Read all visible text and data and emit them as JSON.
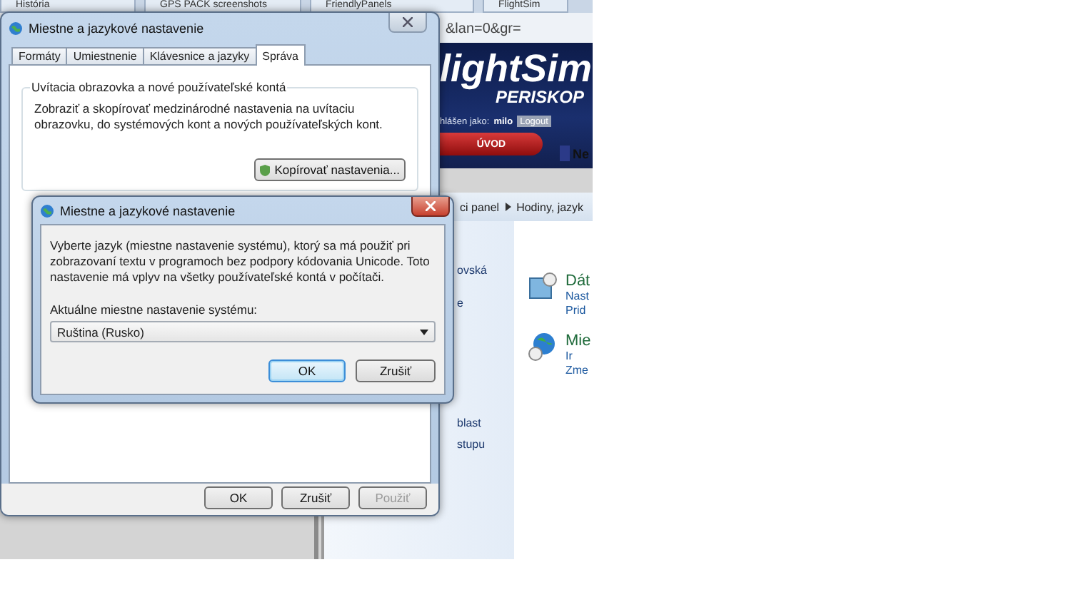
{
  "browser": {
    "tabs": [
      "História",
      "GPS PACK screenshots",
      "FriendlyPanels",
      "FlightSim"
    ],
    "address": "&lan=0&gr="
  },
  "site": {
    "logo": "lightSim",
    "subtitle": "PERISKOP",
    "login_label": "hlášen jako:",
    "user": "milo",
    "logout": "Logout",
    "nav": "ÚVOD",
    "cut_text": "Ne"
  },
  "control_panel": {
    "breadcrumb": [
      "ci panel",
      "Hodiny, jazyk"
    ],
    "left_links": [
      "ovská",
      "e",
      "blast",
      "stupu"
    ],
    "items": [
      {
        "title": "Dát",
        "links": [
          "Nast",
          "Prid"
        ]
      },
      {
        "title": "Mie",
        "links": [
          "Ir",
          "Zme"
        ]
      }
    ]
  },
  "main_dialog": {
    "title": "Miestne a jazykové nastavenie",
    "tabs": [
      {
        "label": "Formáty",
        "selected": false
      },
      {
        "label": "Umiestnenie",
        "selected": false
      },
      {
        "label": "Klávesnice a jazyky",
        "selected": false
      },
      {
        "label": "Správa",
        "selected": true
      }
    ],
    "group_title": "Uvítacia obrazovka a nové používateľské kontá",
    "description": "Zobraziť a skopírovať medzinárodné nastavenia na uvítaciu obrazovku, do systémových kont a nových používateľských kont.",
    "copy_button": "Kopírovať nastavenia...",
    "buttons": [
      {
        "label": "OK",
        "disabled": false
      },
      {
        "label": "Zrušiť",
        "disabled": false
      },
      {
        "label": "Použiť",
        "disabled": true
      }
    ]
  },
  "modal": {
    "title": "Miestne a jazykové nastavenie",
    "description": "Vyberte jazyk (miestne nastavenie systému), ktorý sa má použiť pri zobrazovaní textu v programoch bez podpory kódovania Unicode. Toto nastavenie má vplyv na všetky používateľské kontá v počítači.",
    "field_label": "Aktuálne miestne nastavenie systému:",
    "select_value": "Ruština (Rusko)",
    "buttons": [
      {
        "label": "OK",
        "default": true
      },
      {
        "label": "Zrušiť",
        "default": false
      }
    ]
  }
}
